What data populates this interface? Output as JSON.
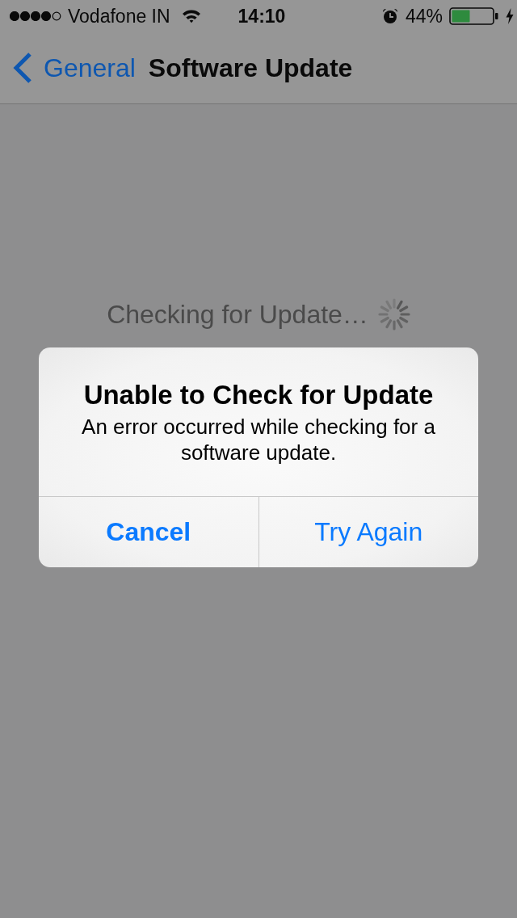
{
  "status_bar": {
    "carrier": "Vodafone IN",
    "time": "14:10",
    "battery_percent": "44%"
  },
  "nav_bar": {
    "back_label": "General",
    "title": "Software Update"
  },
  "content": {
    "status_text": "Checking for Update…"
  },
  "alert": {
    "title": "Unable to Check for Update",
    "message": "An error occurred while checking for a software update.",
    "buttons": [
      {
        "label": "Cancel",
        "kind": "preferred"
      },
      {
        "label": "Try Again",
        "kind": "normal"
      }
    ]
  }
}
